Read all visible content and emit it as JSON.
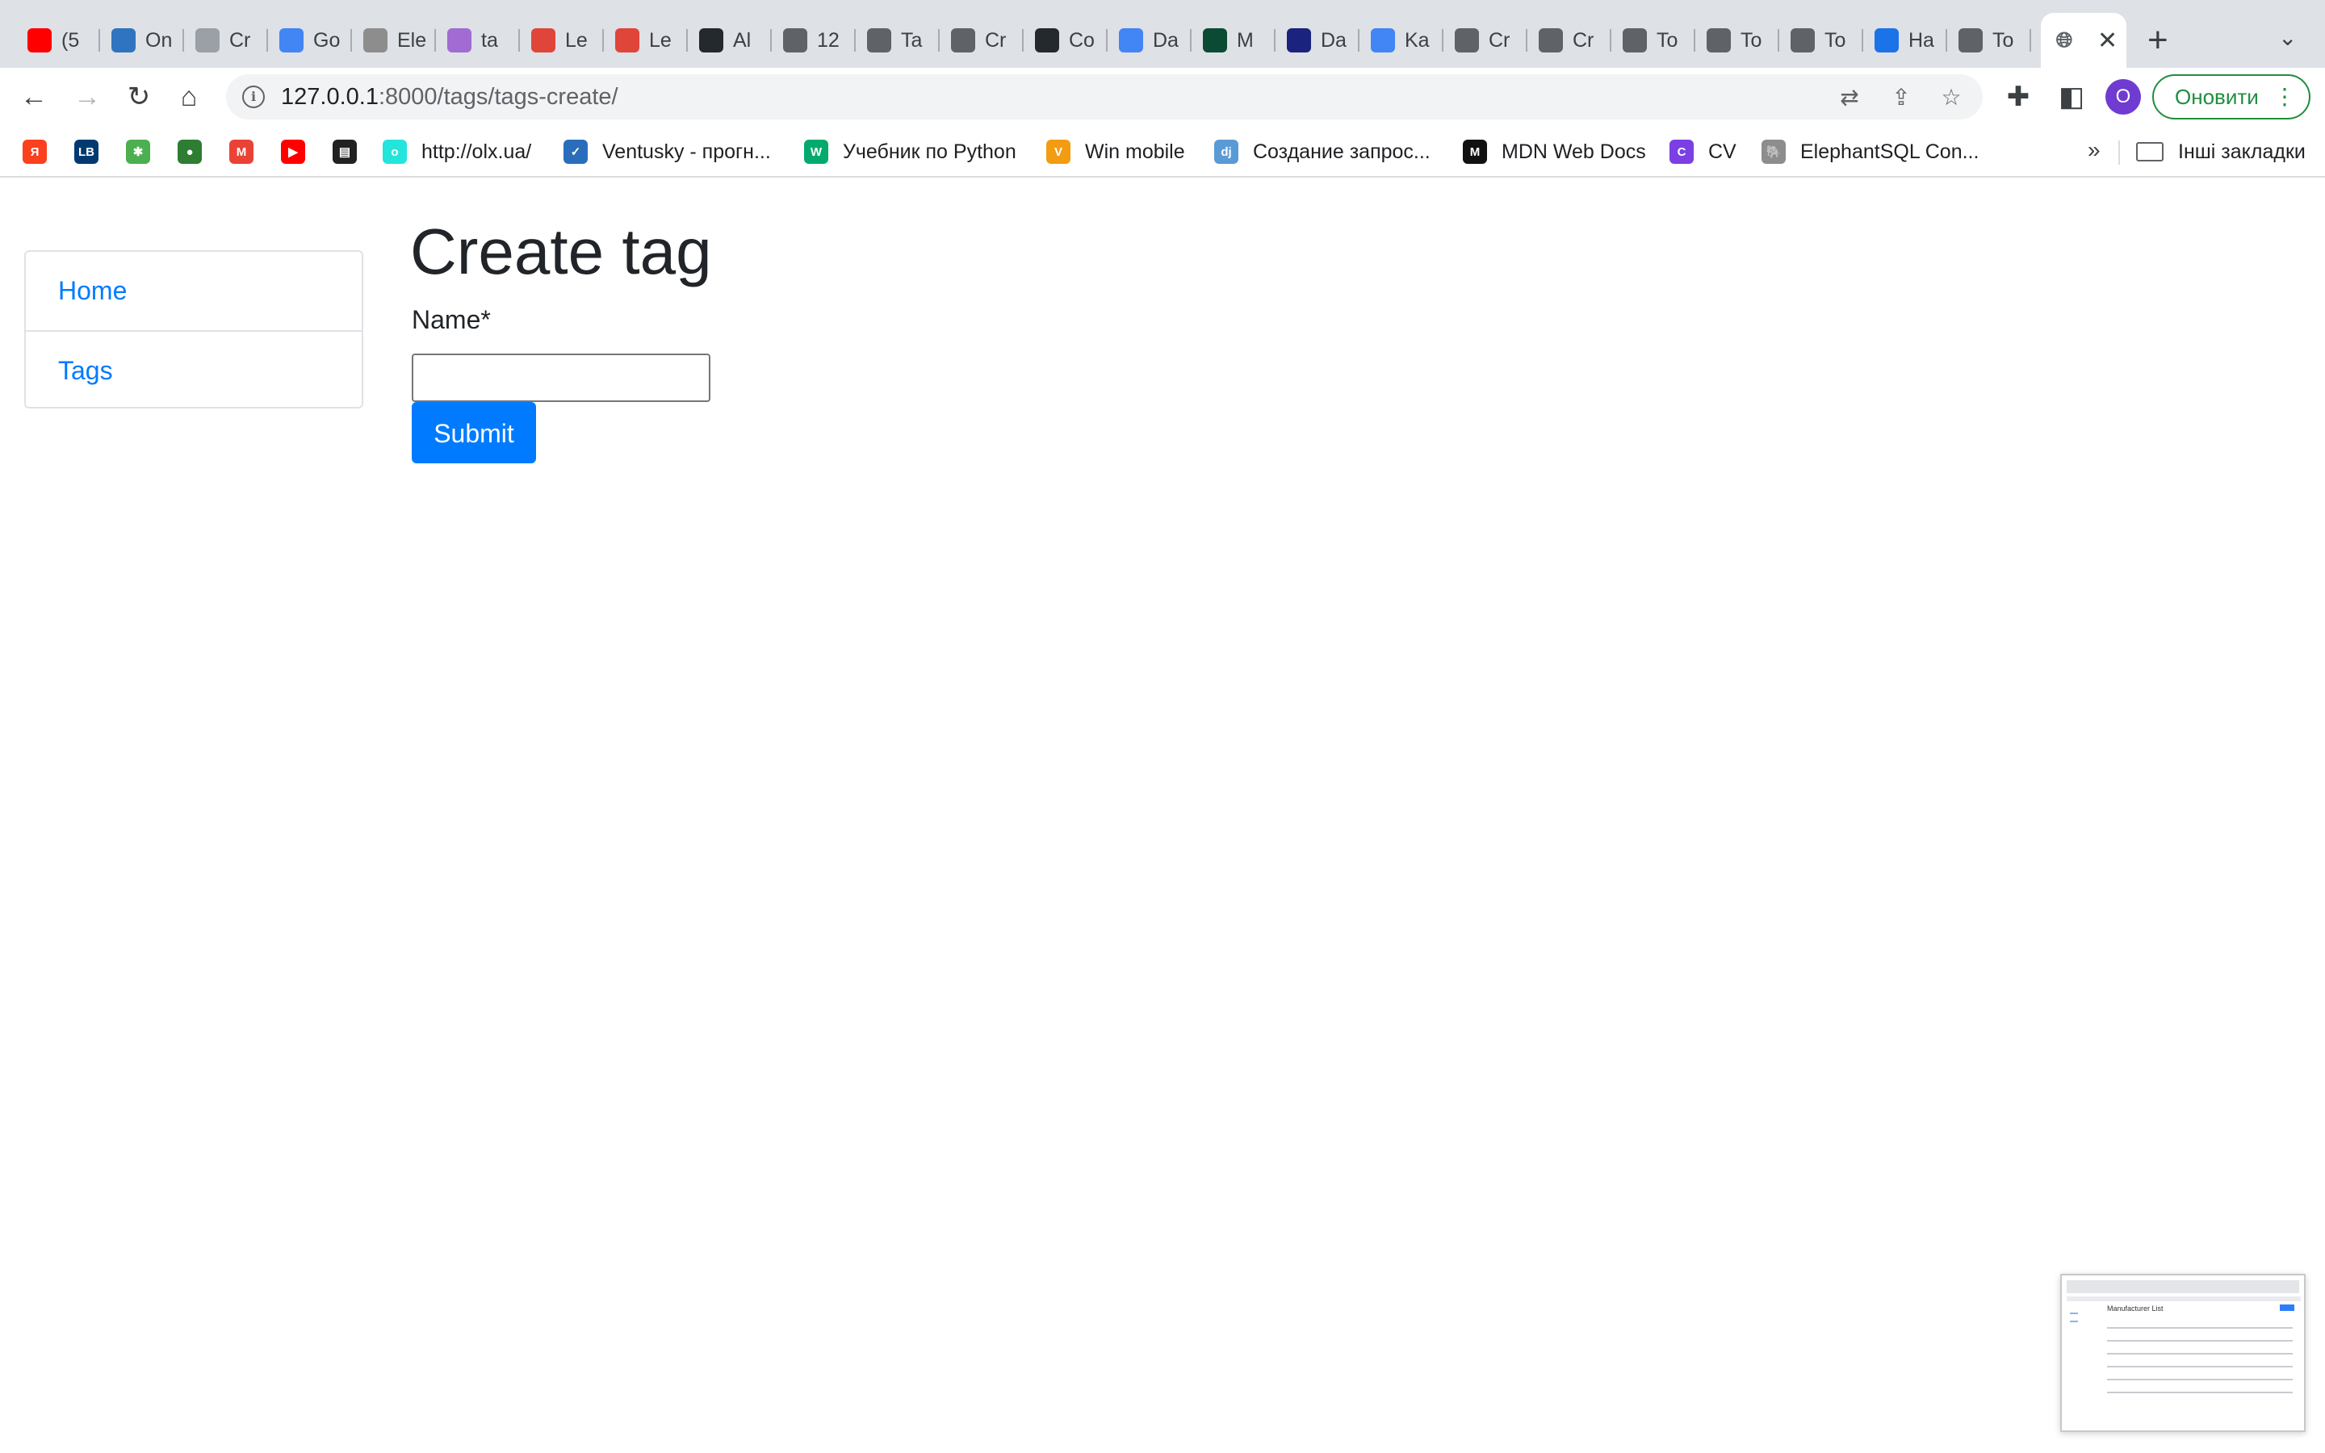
{
  "browser": {
    "tabs": [
      {
        "label": "(5",
        "icon": "youtube-icon",
        "color": "#ff0000"
      },
      {
        "label": "On",
        "icon": "ts-icon",
        "color": "#2f74c0"
      },
      {
        "label": "Cr",
        "icon": "document-icon",
        "color": "#9aa0a6"
      },
      {
        "label": "Go",
        "icon": "google-translate-icon",
        "color": "#4285f4"
      },
      {
        "label": "Ele",
        "icon": "elephant-icon",
        "color": "#8d8d8d"
      },
      {
        "label": "ta",
        "icon": "h-logo-icon",
        "color": "#a16bd3"
      },
      {
        "label": "Le",
        "icon": "mate-icon",
        "color": "#e0453a"
      },
      {
        "label": "Le",
        "icon": "mate-icon",
        "color": "#e0453a"
      },
      {
        "label": "Al",
        "icon": "github-icon",
        "color": "#24292e"
      },
      {
        "label": "12",
        "icon": "globe-icon",
        "color": "#5f6368"
      },
      {
        "label": "Ta",
        "icon": "globe-icon",
        "color": "#5f6368"
      },
      {
        "label": "Cr",
        "icon": "globe-icon",
        "color": "#5f6368"
      },
      {
        "label": "Co",
        "icon": "github-icon",
        "color": "#24292e"
      },
      {
        "label": "Da",
        "icon": "google-icon",
        "color": "#4285f4"
      },
      {
        "label": "M",
        "icon": "django-icon",
        "color": "#0c4b33"
      },
      {
        "label": "Da",
        "icon": "diamond-icon",
        "color": "#1a237e"
      },
      {
        "label": "Ka",
        "icon": "google-icon",
        "color": "#4285f4"
      },
      {
        "label": "Cr",
        "icon": "globe-icon",
        "color": "#5f6368"
      },
      {
        "label": "Cr",
        "icon": "globe-icon",
        "color": "#5f6368"
      },
      {
        "label": "To",
        "icon": "globe-icon",
        "color": "#5f6368"
      },
      {
        "label": "To",
        "icon": "globe-icon",
        "color": "#5f6368"
      },
      {
        "label": "To",
        "icon": "globe-icon",
        "color": "#5f6368"
      },
      {
        "label": "Ha",
        "icon": "gear-icon",
        "color": "#1a73e8"
      },
      {
        "label": "To",
        "icon": "globe-icon",
        "color": "#5f6368"
      }
    ],
    "active_tab": {
      "icon": "globe-icon",
      "close": "✕"
    },
    "new_tab": "+",
    "tab_menu": "⌄",
    "url": {
      "host": "127.0.0.1",
      "rest": ":8000/tags/tags-create/"
    },
    "profile_initial": "O",
    "update_label": "Оновити",
    "bookmarks": [
      {
        "label": "",
        "icon": "yandex-icon",
        "color": "#fc3f1d",
        "glyph": "Я"
      },
      {
        "label": "",
        "icon": "lb-icon",
        "color": "#003a70",
        "glyph": "LB"
      },
      {
        "label": "",
        "icon": "star-colorful-icon",
        "color": "#4caf50",
        "glyph": "✱"
      },
      {
        "label": "",
        "icon": "green-ball-icon",
        "color": "#2e7d32",
        "glyph": "●"
      },
      {
        "label": "",
        "icon": "gmail-icon",
        "color": "#ea4335",
        "glyph": "M"
      },
      {
        "label": "",
        "icon": "youtube-icon",
        "color": "#ff0000",
        "glyph": "▶"
      },
      {
        "label": "",
        "icon": "terminal-icon",
        "color": "#222222",
        "glyph": "▤"
      },
      {
        "label": "http://olx.ua/",
        "icon": "olx-icon",
        "color": "#23e5db",
        "glyph": "o"
      },
      {
        "label": "Ventusky - прогн...",
        "icon": "ventusky-icon",
        "color": "#2a6ebb",
        "glyph": "✓"
      },
      {
        "label": "Учебник по Python",
        "icon": "w3-icon",
        "color": "#04aa6d",
        "glyph": "W"
      },
      {
        "label": "Win mobile",
        "icon": "win-mobile-icon",
        "color": "#f39c12",
        "glyph": "V"
      },
      {
        "label": "Создание запрос...",
        "icon": "django-icon",
        "color": "#5b9bd5",
        "glyph": "dj"
      },
      {
        "label": "MDN Web Docs",
        "icon": "mdn-icon",
        "color": "#111111",
        "glyph": "M"
      },
      {
        "label": "CV",
        "icon": "canva-icon",
        "color": "#7b3fe4",
        "glyph": "C"
      },
      {
        "label": "ElephantSQL Con...",
        "icon": "elephant-icon",
        "color": "#8d8d8d",
        "glyph": "🐘"
      }
    ],
    "bookmarks_more": "»",
    "other_bookmarks": "Інші закладки"
  },
  "sidebar": {
    "items": [
      {
        "label": "Home"
      },
      {
        "label": "Tags"
      }
    ]
  },
  "main": {
    "title": "Create tag",
    "name_label": "Name*",
    "name_value": "",
    "submit_label": "Submit"
  },
  "preview": {
    "title": "Manufacturer List"
  },
  "colors": {
    "link": "#007bff",
    "primary_button": "#007bff",
    "update_green": "#1e8e3e",
    "profile": "#6f3bd1"
  }
}
